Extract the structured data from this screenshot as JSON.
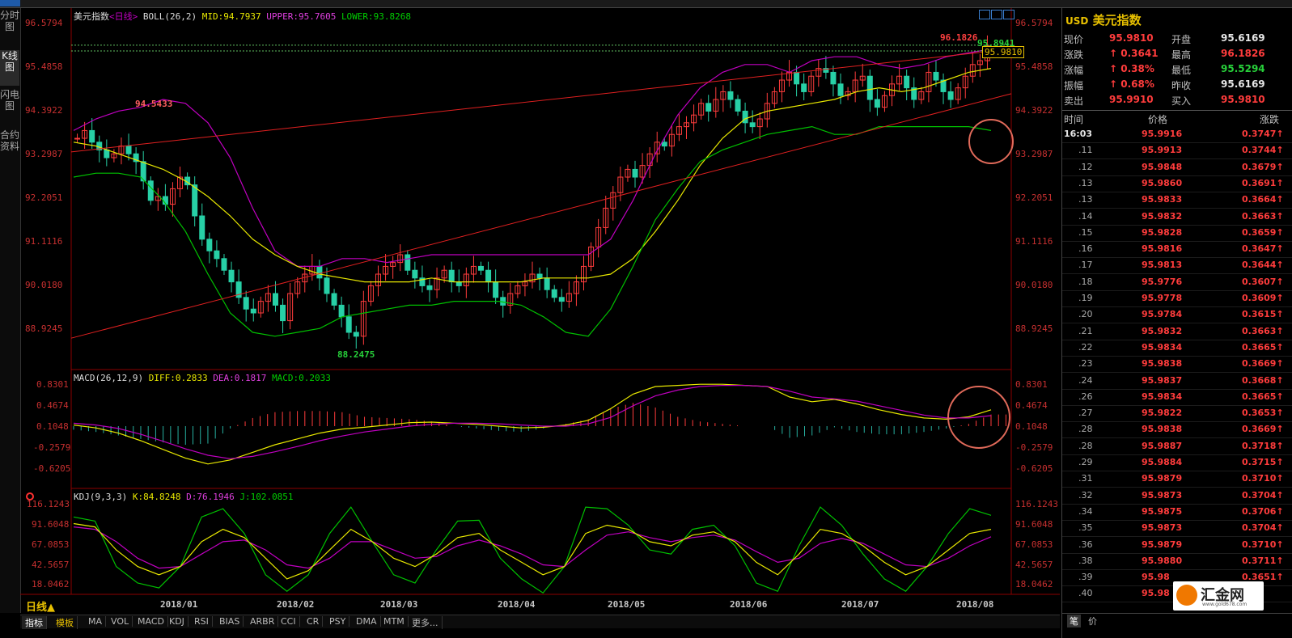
{
  "colors": {
    "up": "#ff3c3c",
    "down": "#27d0a6",
    "mid": "#e8e800",
    "upper": "#c000c0",
    "lower": "#00c000",
    "accent": "#e8c000",
    "grid": "#8b0000"
  },
  "main_legend": {
    "name": "美元指数",
    "sub": "<日线>",
    "indicator": "BOLL(26,2)",
    "mid": "MID:94.7937",
    "upper": "UPPER:95.7605",
    "lower": "LOWER:93.8268"
  },
  "macd_legend": {
    "name": "MACD(26,12,9)",
    "diff": "DIFF:0.2833",
    "dea": "DEA:0.1817",
    "macd": "MACD:0.2033"
  },
  "kdj_legend": {
    "name": "KDJ(9,3,3)",
    "k": "K:84.8248",
    "d": "D:76.1946",
    "j": "J:102.0851"
  },
  "price_axis": [
    "96.5794",
    "95.4858",
    "94.3922",
    "93.2987",
    "92.2051",
    "91.1116",
    "90.0180",
    "88.9245"
  ],
  "macd_axis": [
    "0.8301",
    "0.4674",
    "0.1048",
    "-0.2579",
    "-0.6205"
  ],
  "kdj_axis": [
    "116.1243",
    "91.6048",
    "67.0853",
    "42.5657",
    "18.0462"
  ],
  "x_labels": [
    "2018/01",
    "2018/02",
    "2018/03",
    "2018/04",
    "2018/05",
    "2018/06",
    "2018/07",
    "2018/08"
  ],
  "annotations": {
    "high_marker": "96.1826",
    "high_now": "95.8941",
    "left_high": "94.5433",
    "low": "88.2475",
    "current_price": "95.9810"
  },
  "left_tabs": [
    "分时图",
    "K线图",
    "闪电图",
    "合约资料"
  ],
  "period_label": "日线▲",
  "bottom_tabs": [
    "指标",
    "模板",
    "MA",
    "VOL",
    "MACD",
    "KDJ",
    "RSI",
    "BIAS",
    "ARBR",
    "CCI",
    "CR",
    "PSY",
    "DMA",
    "MTM",
    "更多..."
  ],
  "quote": {
    "title_code": "USD",
    "title_name": "美元指数",
    "rows": [
      {
        "l1": "现价",
        "v1": "95.9810",
        "c1": "red",
        "l2": "开盘",
        "v2": "95.6169",
        "c2": "white"
      },
      {
        "l1": "涨跌",
        "v1": "0.3641",
        "c1": "red",
        "l2": "最高",
        "v2": "96.1826",
        "c2": "red"
      },
      {
        "l1": "涨幅",
        "v1": "0.38%",
        "c1": "red",
        "l2": "最低",
        "v2": "95.5294",
        "c2": "green"
      },
      {
        "l1": "振幅",
        "v1": "0.68%",
        "c1": "red",
        "l2": "昨收",
        "v2": "95.6169",
        "c2": "white"
      },
      {
        "l1": "卖出",
        "v1": "95.9910",
        "c1": "red",
        "l2": "买入",
        "v2": "95.9810",
        "c2": "red"
      }
    ]
  },
  "ticks": {
    "headers": [
      "时间",
      "价格",
      "涨跌"
    ],
    "rows": [
      {
        "t": "16:03",
        "p": "95.9916",
        "c": "0.3747"
      },
      {
        "t": ".11",
        "p": "95.9913",
        "c": "0.3744"
      },
      {
        "t": ".12",
        "p": "95.9848",
        "c": "0.3679"
      },
      {
        "t": ".13",
        "p": "95.9860",
        "c": "0.3691"
      },
      {
        "t": ".13",
        "p": "95.9833",
        "c": "0.3664"
      },
      {
        "t": ".14",
        "p": "95.9832",
        "c": "0.3663"
      },
      {
        "t": ".15",
        "p": "95.9828",
        "c": "0.3659"
      },
      {
        "t": ".16",
        "p": "95.9816",
        "c": "0.3647"
      },
      {
        "t": ".17",
        "p": "95.9813",
        "c": "0.3644"
      },
      {
        "t": ".18",
        "p": "95.9776",
        "c": "0.3607"
      },
      {
        "t": ".19",
        "p": "95.9778",
        "c": "0.3609"
      },
      {
        "t": ".20",
        "p": "95.9784",
        "c": "0.3615"
      },
      {
        "t": ".21",
        "p": "95.9832",
        "c": "0.3663"
      },
      {
        "t": ".22",
        "p": "95.9834",
        "c": "0.3665"
      },
      {
        "t": ".23",
        "p": "95.9838",
        "c": "0.3669"
      },
      {
        "t": ".24",
        "p": "95.9837",
        "c": "0.3668"
      },
      {
        "t": ".26",
        "p": "95.9834",
        "c": "0.3665"
      },
      {
        "t": ".27",
        "p": "95.9822",
        "c": "0.3653"
      },
      {
        "t": ".28",
        "p": "95.9838",
        "c": "0.3669"
      },
      {
        "t": ".28",
        "p": "95.9887",
        "c": "0.3718"
      },
      {
        "t": ".29",
        "p": "95.9884",
        "c": "0.3715"
      },
      {
        "t": ".31",
        "p": "95.9879",
        "c": "0.3710"
      },
      {
        "t": ".32",
        "p": "95.9873",
        "c": "0.3704"
      },
      {
        "t": ".34",
        "p": "95.9875",
        "c": "0.3706"
      },
      {
        "t": ".35",
        "p": "95.9873",
        "c": "0.3704"
      },
      {
        "t": ".36",
        "p": "95.9879",
        "c": "0.3710"
      },
      {
        "t": ".38",
        "p": "95.9880",
        "c": "0.3711"
      },
      {
        "t": ".39",
        "p": "95.98",
        "c": "0.3651"
      },
      {
        "t": ".40",
        "p": "95.98",
        "c": ""
      }
    ],
    "footer": [
      "笔",
      "价"
    ]
  },
  "logo": {
    "text": "汇金网",
    "sub": "www.gold678.com"
  },
  "chart_data": {
    "type": "candlestick",
    "title": "美元指数",
    "xlabel": "",
    "ylabel": "",
    "x_ticks": [
      "2018/01",
      "2018/02",
      "2018/03",
      "2018/04",
      "2018/05",
      "2018/06",
      "2018/07",
      "2018/08"
    ],
    "ylim": [
      88.1,
      96.58
    ],
    "series": [
      {
        "name": "close",
        "values": [
          93.6,
          93.8,
          93.5,
          93.3,
          93.1,
          93.2,
          93.4,
          93.2,
          93.0,
          92.5,
          92.0,
          92.1,
          91.9,
          92.3,
          92.6,
          92.4,
          91.6,
          91.0,
          90.7,
          90.5,
          90.2,
          89.9,
          89.5,
          89.2,
          89.1,
          89.4,
          89.6,
          89.3,
          88.9,
          89.6,
          89.9,
          90.1,
          90.3,
          90.0,
          89.6,
          89.3,
          89.0,
          88.6,
          88.5,
          89.4,
          89.8,
          90.1,
          90.3,
          90.4,
          90.6,
          90.2,
          90.0,
          89.8,
          89.7,
          90.0,
          90.2,
          89.9,
          89.8,
          90.1,
          90.3,
          90.2,
          89.9,
          89.5,
          89.3,
          89.6,
          89.8,
          89.9,
          90.1,
          90.0,
          89.7,
          89.5,
          89.4,
          89.6,
          89.9,
          90.3,
          90.8,
          91.3,
          91.8,
          92.2,
          92.6,
          92.8,
          92.6,
          92.9,
          93.2,
          93.5,
          93.4,
          93.7,
          93.9,
          94.0,
          94.2,
          94.5,
          94.3,
          94.6,
          94.8,
          94.6,
          94.3,
          94.0,
          93.9,
          94.1,
          94.5,
          94.8,
          95.1,
          95.3,
          95.0,
          94.8,
          95.2,
          95.4,
          95.3,
          95.0,
          94.7,
          94.8,
          95.1,
          95.2,
          94.6,
          94.4,
          94.7,
          95.0,
          95.2,
          94.9,
          94.6,
          94.8,
          95.3,
          95.1,
          94.8,
          94.6,
          94.9,
          95.2,
          95.5,
          95.6,
          95.98
        ]
      },
      {
        "name": "MID",
        "values": [
          93.5,
          93.4,
          93.2,
          93.0,
          92.8,
          92.5,
          92.1,
          91.6,
          91.0,
          90.6,
          90.3,
          90.1,
          90.0,
          89.9,
          89.9,
          89.9,
          90.0,
          89.9,
          89.9,
          89.9,
          89.9,
          90.0,
          90.0,
          90.0,
          90.1,
          90.5,
          91.2,
          92.0,
          92.9,
          93.6,
          94.1,
          94.3,
          94.4,
          94.5,
          94.6,
          94.8,
          94.9,
          94.8,
          94.9,
          95.1,
          95.3,
          95.4
        ]
      },
      {
        "name": "UPPER",
        "values": [
          93.8,
          94.1,
          94.3,
          94.4,
          94.6,
          94.5,
          94.0,
          93.1,
          91.8,
          90.7,
          90.3,
          90.3,
          90.5,
          90.5,
          90.4,
          90.5,
          90.6,
          90.6,
          90.6,
          90.6,
          90.6,
          90.6,
          90.6,
          90.6,
          91.0,
          92.0,
          93.2,
          94.2,
          94.9,
          95.3,
          95.5,
          95.5,
          95.3,
          95.6,
          95.7,
          95.7,
          95.5,
          95.4,
          95.5,
          95.7,
          95.8,
          95.9
        ]
      },
      {
        "name": "LOWER",
        "values": [
          92.6,
          92.7,
          92.7,
          92.6,
          92.0,
          91.2,
          90.1,
          89.1,
          88.6,
          88.5,
          88.6,
          88.7,
          89.0,
          89.1,
          89.2,
          89.3,
          89.3,
          89.4,
          89.4,
          89.4,
          89.3,
          89.0,
          88.6,
          88.5,
          89.2,
          90.3,
          91.5,
          92.3,
          93.0,
          93.3,
          93.5,
          93.7,
          93.8,
          93.9,
          93.7,
          93.7,
          93.9,
          93.9,
          93.9,
          93.9,
          93.9,
          93.8
        ]
      },
      {
        "name": "DIFF",
        "values": [
          0.02,
          -0.03,
          -0.12,
          -0.25,
          -0.4,
          -0.55,
          -0.65,
          -0.58,
          -0.45,
          -0.32,
          -0.22,
          -0.12,
          -0.05,
          -0.02,
          0.02,
          0.06,
          0.07,
          0.05,
          0.03,
          0.0,
          -0.03,
          -0.02,
          0.02,
          0.1,
          0.3,
          0.55,
          0.68,
          0.7,
          0.72,
          0.72,
          0.7,
          0.68,
          0.5,
          0.42,
          0.46,
          0.38,
          0.28,
          0.2,
          0.14,
          0.12,
          0.16,
          0.28
        ]
      },
      {
        "name": "DEA",
        "values": [
          0.05,
          0.02,
          -0.04,
          -0.14,
          -0.26,
          -0.39,
          -0.5,
          -0.56,
          -0.52,
          -0.44,
          -0.35,
          -0.25,
          -0.17,
          -0.1,
          -0.05,
          0.0,
          0.03,
          0.05,
          0.05,
          0.04,
          0.02,
          0.0,
          0.0,
          0.04,
          0.15,
          0.35,
          0.52,
          0.62,
          0.68,
          0.7,
          0.7,
          0.68,
          0.6,
          0.5,
          0.47,
          0.43,
          0.35,
          0.27,
          0.19,
          0.14,
          0.14,
          0.18
        ]
      },
      {
        "name": "K",
        "values": [
          92,
          88,
          60,
          40,
          30,
          40,
          70,
          85,
          75,
          50,
          25,
          35,
          60,
          85,
          70,
          50,
          40,
          55,
          75,
          80,
          60,
          45,
          30,
          40,
          80,
          90,
          85,
          70,
          65,
          78,
          82,
          70,
          45,
          30,
          55,
          85,
          80,
          65,
          45,
          30,
          40,
          60,
          80,
          85
        ]
      },
      {
        "name": "D",
        "values": [
          88,
          85,
          70,
          50,
          38,
          40,
          55,
          70,
          72,
          60,
          42,
          38,
          50,
          70,
          70,
          60,
          50,
          52,
          65,
          72,
          65,
          55,
          42,
          40,
          60,
          78,
          82,
          75,
          70,
          75,
          78,
          72,
          58,
          45,
          50,
          68,
          74,
          68,
          55,
          42,
          40,
          50,
          65,
          76
        ]
      },
      {
        "name": "J",
        "values": [
          100,
          95,
          40,
          20,
          14,
          40,
          100,
          110,
          80,
          30,
          10,
          30,
          80,
          112,
          70,
          30,
          20,
          60,
          95,
          96,
          50,
          25,
          8,
          40,
          112,
          110,
          90,
          60,
          55,
          85,
          90,
          65,
          20,
          10,
          65,
          112,
          90,
          55,
          25,
          10,
          40,
          80,
          110,
          102
        ]
      }
    ]
  }
}
